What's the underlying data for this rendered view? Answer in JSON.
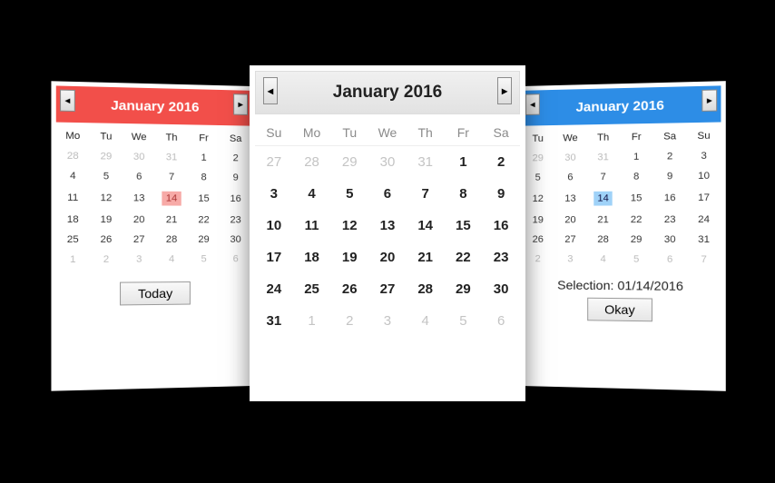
{
  "left": {
    "title": "January 2016",
    "cols": [
      "Mo",
      "Tu",
      "We",
      "Th",
      "Fr",
      "Sa"
    ],
    "rows": [
      [
        {
          "v": "28",
          "d": 1
        },
        {
          "v": "29",
          "d": 1
        },
        {
          "v": "30",
          "d": 1
        },
        {
          "v": "31",
          "d": 1
        },
        {
          "v": "1"
        },
        {
          "v": "2"
        }
      ],
      [
        {
          "v": "4"
        },
        {
          "v": "5"
        },
        {
          "v": "6"
        },
        {
          "v": "7"
        },
        {
          "v": "8"
        },
        {
          "v": "9"
        }
      ],
      [
        {
          "v": "11"
        },
        {
          "v": "12"
        },
        {
          "v": "13"
        },
        {
          "v": "14",
          "s": 1
        },
        {
          "v": "15"
        },
        {
          "v": "16"
        }
      ],
      [
        {
          "v": "18"
        },
        {
          "v": "19"
        },
        {
          "v": "20"
        },
        {
          "v": "21"
        },
        {
          "v": "22"
        },
        {
          "v": "23"
        }
      ],
      [
        {
          "v": "25"
        },
        {
          "v": "26"
        },
        {
          "v": "27"
        },
        {
          "v": "28"
        },
        {
          "v": "29"
        },
        {
          "v": "30"
        }
      ],
      [
        {
          "v": "1",
          "d": 1
        },
        {
          "v": "2",
          "d": 1
        },
        {
          "v": "3",
          "d": 1
        },
        {
          "v": "4",
          "d": 1
        },
        {
          "v": "5",
          "d": 1
        },
        {
          "v": "6",
          "d": 1
        }
      ]
    ],
    "today_label": "Today"
  },
  "center": {
    "title": "January 2016",
    "cols": [
      "Su",
      "Mo",
      "Tu",
      "We",
      "Th",
      "Fr",
      "Sa"
    ],
    "rows": [
      [
        {
          "v": "27",
          "d": 1
        },
        {
          "v": "28",
          "d": 1
        },
        {
          "v": "29",
          "d": 1
        },
        {
          "v": "30",
          "d": 1
        },
        {
          "v": "31",
          "d": 1
        },
        {
          "v": "1"
        },
        {
          "v": "2"
        }
      ],
      [
        {
          "v": "3"
        },
        {
          "v": "4"
        },
        {
          "v": "5"
        },
        {
          "v": "6"
        },
        {
          "v": "7"
        },
        {
          "v": "8"
        },
        {
          "v": "9"
        }
      ],
      [
        {
          "v": "10"
        },
        {
          "v": "11"
        },
        {
          "v": "12"
        },
        {
          "v": "13"
        },
        {
          "v": "14"
        },
        {
          "v": "15"
        },
        {
          "v": "16"
        }
      ],
      [
        {
          "v": "17"
        },
        {
          "v": "18"
        },
        {
          "v": "19"
        },
        {
          "v": "20"
        },
        {
          "v": "21"
        },
        {
          "v": "22"
        },
        {
          "v": "23"
        }
      ],
      [
        {
          "v": "24"
        },
        {
          "v": "25"
        },
        {
          "v": "26"
        },
        {
          "v": "27"
        },
        {
          "v": "28"
        },
        {
          "v": "29"
        },
        {
          "v": "30"
        }
      ],
      [
        {
          "v": "31"
        },
        {
          "v": "1",
          "d": 1
        },
        {
          "v": "2",
          "d": 1
        },
        {
          "v": "3",
          "d": 1
        },
        {
          "v": "4",
          "d": 1
        },
        {
          "v": "5",
          "d": 1
        },
        {
          "v": "6",
          "d": 1
        }
      ]
    ]
  },
  "right": {
    "title": "January 2016",
    "cols": [
      "Tu",
      "We",
      "Th",
      "Fr",
      "Sa",
      "Su"
    ],
    "rows": [
      [
        {
          "v": "29",
          "d": 1
        },
        {
          "v": "30",
          "d": 1
        },
        {
          "v": "31",
          "d": 1
        },
        {
          "v": "1"
        },
        {
          "v": "2"
        },
        {
          "v": "3"
        }
      ],
      [
        {
          "v": "5"
        },
        {
          "v": "6"
        },
        {
          "v": "7"
        },
        {
          "v": "8"
        },
        {
          "v": "9"
        },
        {
          "v": "10"
        }
      ],
      [
        {
          "v": "12"
        },
        {
          "v": "13"
        },
        {
          "v": "14",
          "s": 1
        },
        {
          "v": "15"
        },
        {
          "v": "16"
        },
        {
          "v": "17"
        }
      ],
      [
        {
          "v": "19"
        },
        {
          "v": "20"
        },
        {
          "v": "21"
        },
        {
          "v": "22"
        },
        {
          "v": "23"
        },
        {
          "v": "24"
        }
      ],
      [
        {
          "v": "26"
        },
        {
          "v": "27"
        },
        {
          "v": "28"
        },
        {
          "v": "29"
        },
        {
          "v": "30"
        },
        {
          "v": "31"
        }
      ],
      [
        {
          "v": "2",
          "d": 1
        },
        {
          "v": "3",
          "d": 1
        },
        {
          "v": "4",
          "d": 1
        },
        {
          "v": "5",
          "d": 1
        },
        {
          "v": "6",
          "d": 1
        },
        {
          "v": "7",
          "d": 1
        }
      ]
    ],
    "selection_label": "Selection: 01/14/2016",
    "okay_label": "Okay"
  },
  "glyphs": {
    "left": "◂",
    "right": "▸"
  }
}
